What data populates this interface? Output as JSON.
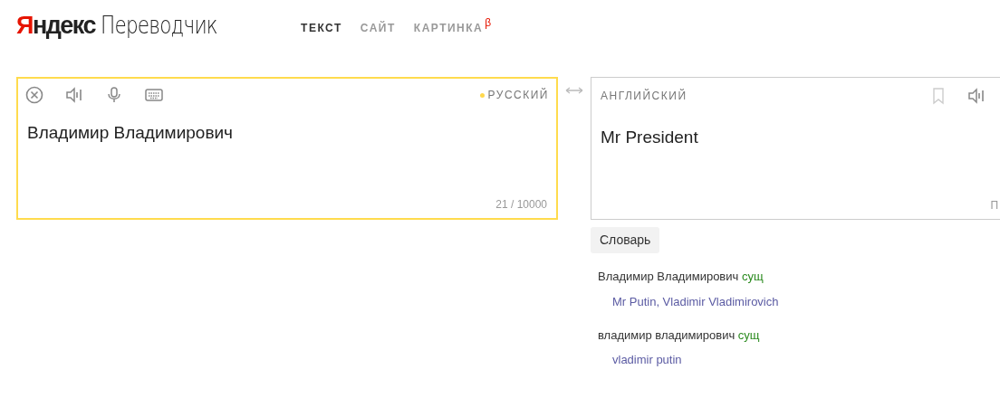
{
  "logo": {
    "brand": "Яндекс",
    "product": "Переводчик"
  },
  "tabs": [
    {
      "label": "ТЕКСТ",
      "selected": true
    },
    {
      "label": "САЙТ",
      "selected": false
    },
    {
      "label": "КАРТИНКА",
      "selected": false,
      "badge": "β"
    }
  ],
  "source": {
    "language": "РУССКИЙ",
    "text": "Владимир Владимирович",
    "counter": "21 / 10000"
  },
  "target": {
    "language": "АНГЛИЙСКИЙ",
    "text": "Mr President",
    "footer": "П"
  },
  "dictionary": {
    "button": "Словарь",
    "entries": [
      {
        "word": "Владимир Владимирович",
        "pos": "сущ",
        "translations": "Mr Putin, Vladimir Vladimirovich"
      },
      {
        "word": "владимир владимирович",
        "pos": "сущ",
        "translations": "vladimir putin"
      }
    ]
  }
}
